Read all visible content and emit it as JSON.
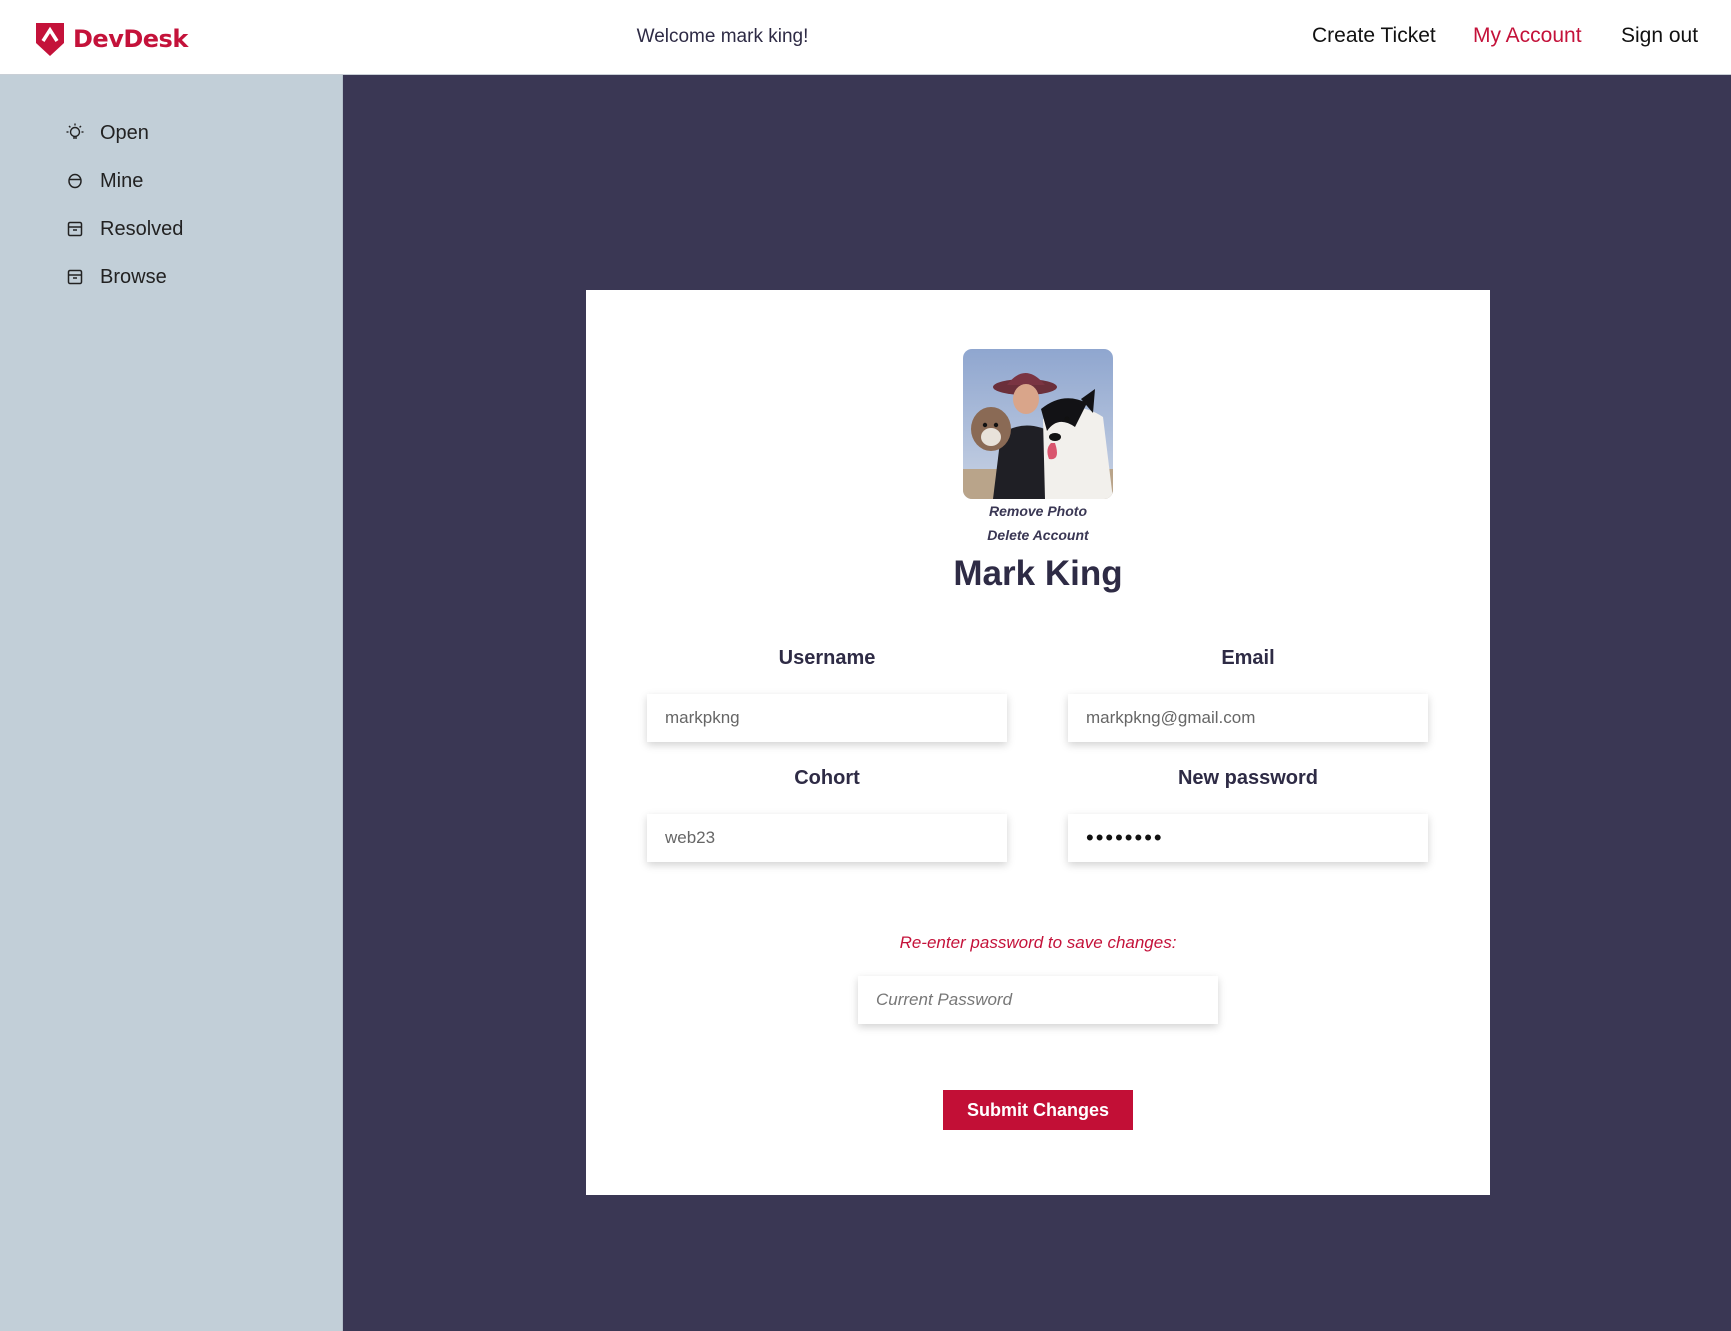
{
  "app": {
    "name": "DevDesk",
    "welcome": "Welcome mark king!"
  },
  "nav": {
    "create_ticket": "Create Ticket",
    "my_account": "My Account",
    "sign_out": "Sign out"
  },
  "sidebar": {
    "items": [
      {
        "label": "Open",
        "icon": "lightbulb-icon"
      },
      {
        "label": "Mine",
        "icon": "user-icon"
      },
      {
        "label": "Resolved",
        "icon": "archive-icon"
      },
      {
        "label": "Browse",
        "icon": "archive-icon"
      }
    ]
  },
  "profile": {
    "remove_photo": "Remove Photo",
    "delete_account": "Delete Account",
    "name": "Mark King"
  },
  "form": {
    "username_label": "Username",
    "username_value": "markpkng",
    "email_label": "Email",
    "email_value": "markpkng@gmail.com",
    "cohort_label": "Cohort",
    "cohort_value": "web23",
    "new_password_label": "New password",
    "new_password_value": "••••••••",
    "reenter_note": "Re-enter password to save changes:",
    "current_password_placeholder": "Current Password",
    "submit_label": "Submit Changes"
  },
  "colors": {
    "brand": "#c4123a",
    "sidebar_bg": "#c2cfd8",
    "main_bg": "#3a3754"
  }
}
